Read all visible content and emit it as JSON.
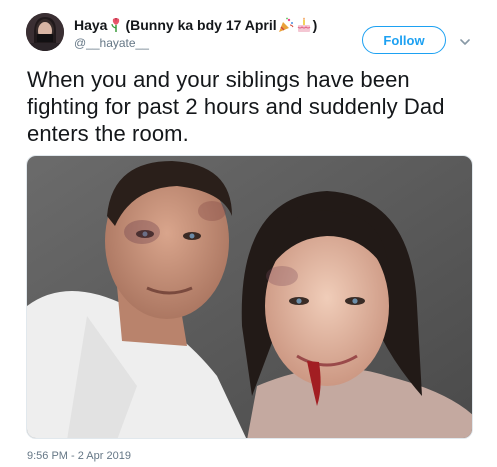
{
  "author": {
    "display_name_prefix": "Haya",
    "display_name_text": "(Bunny ka bdy 17 April",
    "display_name_suffix": ")",
    "handle": "@__hayate__"
  },
  "follow_label": "Follow",
  "tweet_text": "When you and your siblings have been fighting for past 2 hours and suddenly Dad enters the room.",
  "timestamp": "9:56 PM - 2 Apr 2019",
  "icons": {
    "avatar": "profile-photo",
    "emoji_1": "flower-emoji",
    "emoji_2": "party-popper-emoji",
    "emoji_3": "birthday-cake-emoji",
    "more": "chevron-down-icon"
  },
  "colors": {
    "accent": "#1da1f2",
    "text": "#14171a",
    "muted": "#657786"
  }
}
